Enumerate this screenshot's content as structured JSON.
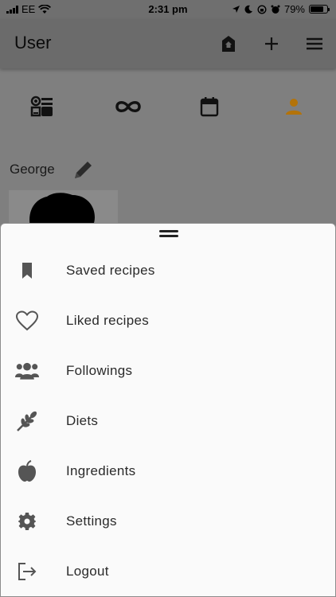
{
  "status_bar": {
    "carrier": "EE",
    "time": "2:31 pm",
    "battery": "79%",
    "battery_level": 0.79
  },
  "app_bar": {
    "title": "User",
    "actions": [
      "home-icon",
      "add-icon",
      "menu-icon"
    ]
  },
  "tabs": [
    {
      "icon": "kitchen-icon",
      "active": false
    },
    {
      "icon": "infinity-icon",
      "active": false
    },
    {
      "icon": "calendar-icon",
      "active": false
    },
    {
      "icon": "person-icon",
      "active": true
    }
  ],
  "profile": {
    "name": "George"
  },
  "colors": {
    "accent": "#b3730a",
    "scrim": "#7f7f7f",
    "sheet_bg": "#fafafa",
    "icon_gray": "#555555"
  },
  "menu": [
    {
      "label": "Saved recipes",
      "icon": "bookmark-icon"
    },
    {
      "label": "Liked recipes",
      "icon": "heart-icon"
    },
    {
      "label": "Followings",
      "icon": "people-icon"
    },
    {
      "label": "Diets",
      "icon": "wheat-icon"
    },
    {
      "label": "Ingredients",
      "icon": "apple-icon"
    },
    {
      "label": "Settings",
      "icon": "gear-icon"
    },
    {
      "label": "Logout",
      "icon": "logout-icon"
    }
  ]
}
